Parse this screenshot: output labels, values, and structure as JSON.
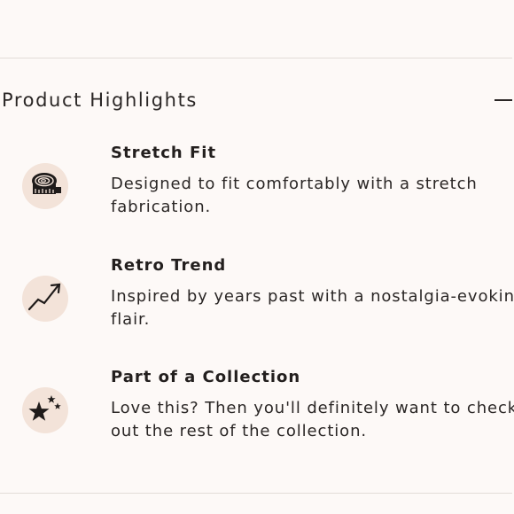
{
  "section": {
    "title": "Product Highlights",
    "collapse_icon": "minus-icon"
  },
  "highlights": [
    {
      "icon": "measuring-tape-icon",
      "title": "Stretch Fit",
      "description_lines": [
        "Designed to fit comfortably with a stretch",
        "fabrication."
      ]
    },
    {
      "icon": "trend-arrow-icon",
      "title": "Retro Trend",
      "description_lines": [
        "Inspired by years past with a nostalgia-evoking",
        "flair."
      ]
    },
    {
      "icon": "stars-icon",
      "title": "Part of a Collection",
      "description_lines": [
        "Love this? Then you'll definitely want to check",
        "out the rest of the collection."
      ]
    }
  ],
  "colors": {
    "background": "#fdf9f7",
    "icon_circle": "#f3e3d9",
    "text": "#2a2625",
    "divider": "#e2dcd8"
  }
}
